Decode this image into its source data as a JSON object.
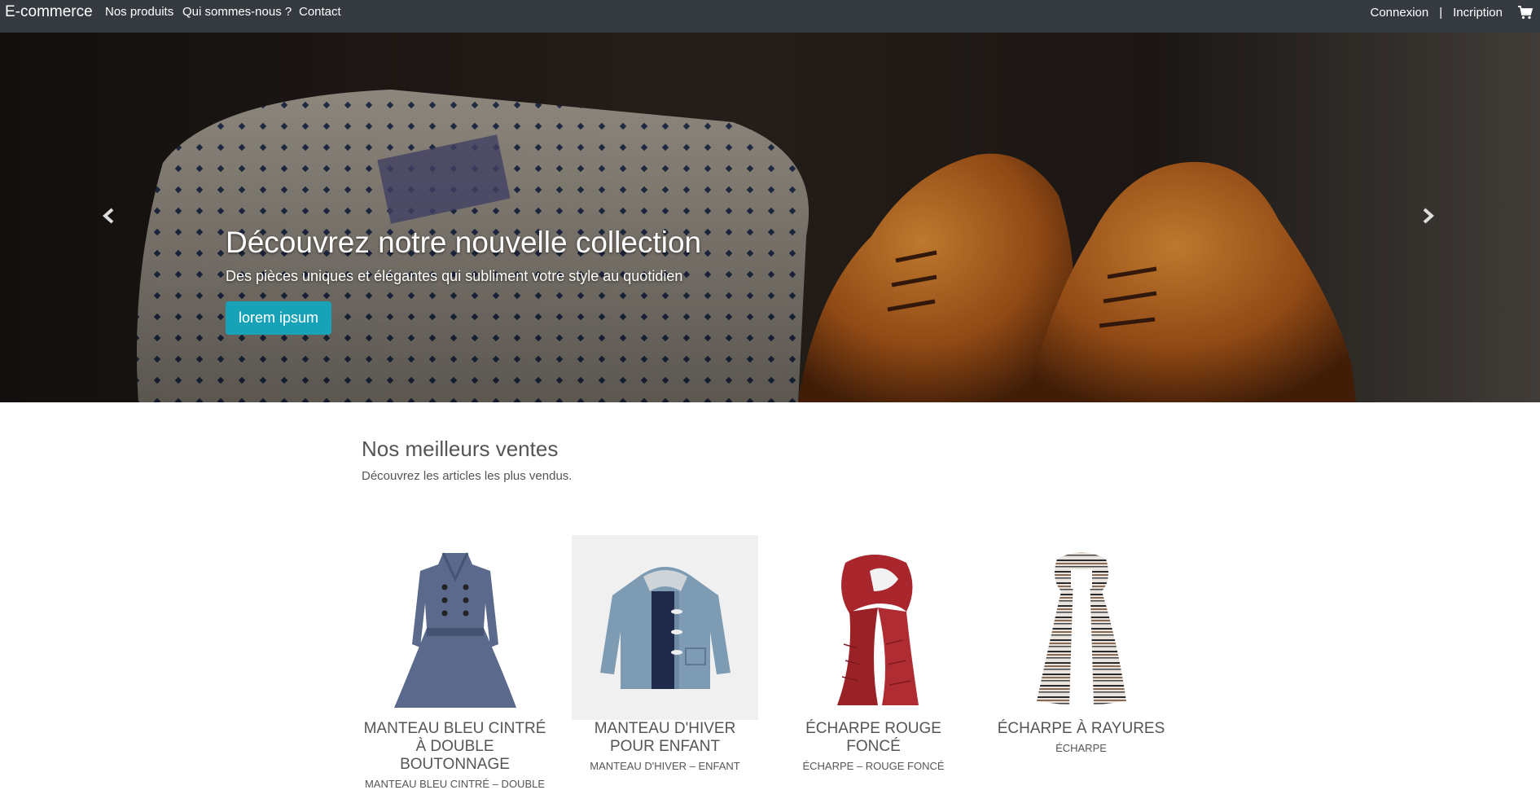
{
  "navbar": {
    "brand": "E-commerce",
    "links": [
      "Nos produits",
      "Qui sommes-nous ?",
      "Contact"
    ],
    "login": "Connexion",
    "separator": "|",
    "signup": "Incription",
    "cart_icon": "cart-icon"
  },
  "hero": {
    "title": "Découvrez notre nouvelle collection",
    "subtitle": "Des pièces uniques et élégantes qui subliment votre style au quotidien",
    "button": "lorem ipsum",
    "prev_icon": "chevron-left-icon",
    "next_icon": "chevron-right-icon"
  },
  "bestsellers": {
    "title": "Nos meilleurs ventes",
    "subtitle": "Découvrez les articles les plus vendus.",
    "products": [
      {
        "name": "MANTEAU BLEU CINTRÉ À DOUBLE BOUTONNAGE",
        "desc": "MANTEAU BLEU CINTRÉ – DOUBLE",
        "icon": "coat-icon"
      },
      {
        "name": "MANTEAU D'HIVER POUR ENFANT",
        "desc": "MANTEAU D'HIVER – ENFANT",
        "icon": "kids-jacket-icon"
      },
      {
        "name": "ÉCHARPE ROUGE FONCÉ",
        "desc": "ÉCHARPE – ROUGE FONCÉ",
        "icon": "red-scarf-icon"
      },
      {
        "name": "ÉCHARPE À RAYURES",
        "desc": "ÉCHARPE",
        "icon": "striped-scarf-icon"
      }
    ]
  },
  "colors": {
    "navbar": "#343a40",
    "accent_button": "#17a2b8"
  }
}
